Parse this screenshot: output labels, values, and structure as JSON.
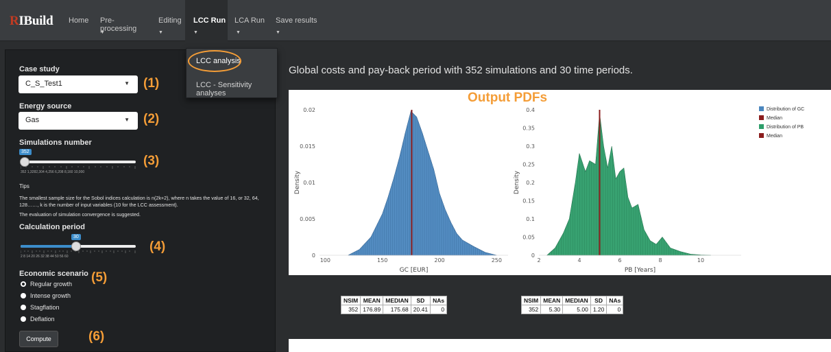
{
  "brand": {
    "logo_r": "R",
    "logo_rest": "IBuild"
  },
  "nav": {
    "home": "Home",
    "preprocessing": "Pre-processing",
    "editing": "Editing",
    "lcc_run": "LCC Run",
    "lca_run": "LCA Run",
    "save_results": "Save results",
    "caret": "▼"
  },
  "dropdown": {
    "item1": "LCC analysis",
    "item2": "LCC - Sensitivity analyses"
  },
  "sidebar": {
    "case_study_label": "Case study",
    "case_study_value": "C_S_Test1",
    "energy_label": "Energy source",
    "energy_value": "Gas",
    "sims_label": "Simulations number",
    "sims_value": "352",
    "sims_tick_labels": "352  1,3282,304     4,256      6,208      8,160     10,000",
    "tips_title": "Tips",
    "tips_text1": "The smallest sample size for the Sobol indices calculation is n(2k+2), where n takes the value of 16, or 32, 64, 128……, k is the number of input variables (10 for the LCC assessment).",
    "tips_text2": "The evaluation of simulation convergence is suggested.",
    "period_label": "Calculation period",
    "period_value": "30",
    "period_tick_labels": "2     8    14   20   26   32   38   44   50   56  60",
    "scenario_label": "Economic scenario",
    "scenarios": [
      "Regular growth",
      "Intense growth",
      "Stagflation",
      "Deflation"
    ],
    "selected_scenario": "Regular growth",
    "compute_label": "Compute",
    "tags": [
      "(1)",
      "(2)",
      "(3)",
      "(4)",
      "(5)",
      "(6)"
    ],
    "select_arrow": "▼",
    "sims_level": 0.0,
    "period_level": 0.48
  },
  "main": {
    "title": "Global costs and pay-back period with 352 simulations and 30 time periods.",
    "plot_heading": "Output PDFs"
  },
  "chart_data": [
    {
      "type": "area",
      "xlabel": "GC [EUR]",
      "ylabel": "Density",
      "xlim": [
        95,
        260
      ],
      "ylim": [
        0,
        0.02
      ],
      "xticks": [
        100,
        150,
        200,
        250
      ],
      "yticks": [
        0,
        0.005,
        0.01,
        0.015,
        0.02
      ],
      "ytick_labels": [
        "0",
        "0.005",
        "0.01",
        "0.015",
        "0.02"
      ],
      "x": [
        120,
        130,
        140,
        150,
        155,
        160,
        165,
        170,
        175,
        180,
        185,
        190,
        195,
        200,
        205,
        210,
        215,
        220,
        230,
        240,
        250
      ],
      "y": [
        0.0,
        0.0008,
        0.0025,
        0.0057,
        0.008,
        0.0106,
        0.0135,
        0.0168,
        0.0198,
        0.019,
        0.0168,
        0.0143,
        0.0118,
        0.0085,
        0.0063,
        0.0045,
        0.003,
        0.0021,
        0.0012,
        0.0004,
        0.0
      ],
      "median": 175.68,
      "series": [
        {
          "name": "Distribution of GC",
          "color": "#4a86be"
        },
        {
          "name": "Median",
          "color": "#8b1d1d"
        }
      ]
    },
    {
      "type": "area",
      "xlabel": "PB [Years]",
      "ylabel": "Density",
      "xlim": [
        2,
        12
      ],
      "ylim": [
        0,
        0.4
      ],
      "xticks": [
        2,
        4,
        6,
        8,
        10
      ],
      "yticks": [
        0,
        0.05,
        0.1,
        0.15,
        0.2,
        0.25,
        0.3,
        0.35,
        0.4
      ],
      "ytick_labels": [
        "0",
        "0.05",
        "0.1",
        "0.15",
        "0.2",
        "0.25",
        "0.3",
        "0.35",
        "0.4"
      ],
      "x": [
        2.4,
        2.8,
        3.2,
        3.5,
        3.8,
        4.0,
        4.3,
        4.5,
        4.8,
        5.0,
        5.2,
        5.4,
        5.6,
        5.8,
        6.0,
        6.2,
        6.4,
        6.6,
        6.9,
        7.2,
        7.5,
        7.8,
        8.1,
        8.5,
        9.0,
        9.5,
        10.0,
        10.5
      ],
      "y": [
        0.0,
        0.02,
        0.06,
        0.1,
        0.2,
        0.28,
        0.23,
        0.26,
        0.25,
        0.39,
        0.3,
        0.24,
        0.3,
        0.21,
        0.23,
        0.24,
        0.16,
        0.13,
        0.14,
        0.07,
        0.04,
        0.03,
        0.05,
        0.02,
        0.01,
        0.003,
        0.001,
        0.0
      ],
      "median": 5.0,
      "series": [
        {
          "name": "Distribution of PB",
          "color": "#2e9e6a"
        },
        {
          "name": "Median",
          "color": "#8b1d1d"
        }
      ]
    }
  ],
  "stats": [
    {
      "headers": [
        "NSIM",
        "MEAN",
        "MEDIAN",
        "SD",
        "NAs"
      ],
      "values": [
        "352",
        "176.89",
        "175.68",
        "20.41",
        "0"
      ]
    },
    {
      "headers": [
        "NSIM",
        "MEAN",
        "MEDIAN",
        "SD",
        "NAs"
      ],
      "values": [
        "352",
        "5.30",
        "5.00",
        "1.20",
        "0"
      ]
    }
  ],
  "colors": {
    "accent": "#f49d37",
    "slider": "#3c8dcb",
    "gc": "#4a86be",
    "pb": "#2e9e6a",
    "median": "#8b1d1d"
  }
}
